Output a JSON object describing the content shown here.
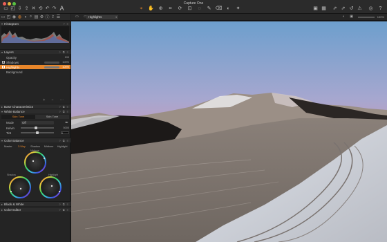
{
  "app": {
    "title": "Capture One"
  },
  "viewer": {
    "image_name": "Highlights",
    "zoom": "100%"
  },
  "panels": {
    "histogram": {
      "title": "Histogram"
    },
    "layers": {
      "title": "Layers",
      "opacity_label": "Opacity",
      "opacity_value": "100",
      "items": [
        {
          "name": "Shadows",
          "checked": true,
          "selected": false,
          "value": "100%"
        },
        {
          "name": "Highlights",
          "checked": true,
          "selected": true,
          "value": "100%"
        },
        {
          "name": "Background",
          "checked": false,
          "selected": false,
          "value": ""
        }
      ]
    },
    "base_characteristics": {
      "title": "Base Characteristics"
    },
    "white_balance": {
      "title": "White Balance",
      "tabs": [
        "Skin Tone",
        "Skin Tone"
      ],
      "mode_label": "Mode",
      "mode_value": "Off",
      "kelvin_label": "Kelvin",
      "kelvin_value": "5000",
      "tint_label": "Tint",
      "tint_value": "0"
    },
    "color_balance": {
      "title": "Color Balance",
      "tabs": [
        "Master",
        "3-Way",
        "Shadow",
        "Midtone",
        "Highlight"
      ],
      "wheel_labels": [
        "Midtone",
        "Shadow",
        "Highlight"
      ]
    },
    "black_white": {
      "title": "Black & White"
    },
    "color_editor": {
      "title": "Color Editor"
    }
  }
}
